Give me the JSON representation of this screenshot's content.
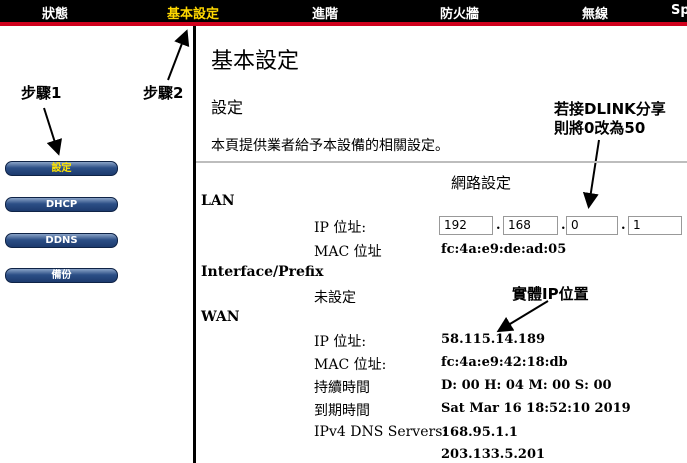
{
  "topnav": {
    "tabs": [
      {
        "label": "狀態",
        "active": false
      },
      {
        "label": "基本設定",
        "active": true
      },
      {
        "label": "進階",
        "active": false
      },
      {
        "label": "防火牆",
        "active": false
      },
      {
        "label": "無線",
        "active": false
      },
      {
        "label": "Sp",
        "active": false
      }
    ]
  },
  "sidebar": {
    "items": [
      {
        "label": "設定",
        "active": true
      },
      {
        "label": "DHCP",
        "active": false
      },
      {
        "label": "DDNS",
        "active": false
      },
      {
        "label": "備份",
        "active": false
      }
    ]
  },
  "annotations": {
    "step1": "步驟1",
    "step2": "步驟2",
    "dlink_line1": "若接DLINK分享",
    "dlink_line2": "則將0改為50",
    "physical_ip": "實體IP位置"
  },
  "page": {
    "title": "基本設定",
    "subtitle": "設定",
    "description": "本頁提供業者給予本設備的相關設定。",
    "section_title": "網路設定"
  },
  "lan": {
    "heading": "LAN",
    "ip_label": "IP 位址:",
    "ip_octets": [
      "192",
      "168",
      "0",
      "1"
    ],
    "mac_label": "MAC 位址",
    "mac_value": "fc:4a:e9:de:ad:05"
  },
  "interface_prefix": {
    "heading": "Interface/Prefix",
    "value": "未設定"
  },
  "wan": {
    "heading": "WAN",
    "ip_label": "IP 位址:",
    "ip_value": "58.115.14.189",
    "mac_label": "MAC 位址:",
    "mac_value": "fc:4a:e9:42:18:db",
    "duration_label": "持續時間",
    "duration_value": "D: 00 H: 04 M: 00 S: 00",
    "expire_label": "到期時間",
    "expire_value": "Sat Mar 16 18:52:10 2019",
    "dns_label": "IPv4 DNS Servers:",
    "dns_values": [
      "168.95.1.1",
      "203.133.5.201"
    ]
  }
}
